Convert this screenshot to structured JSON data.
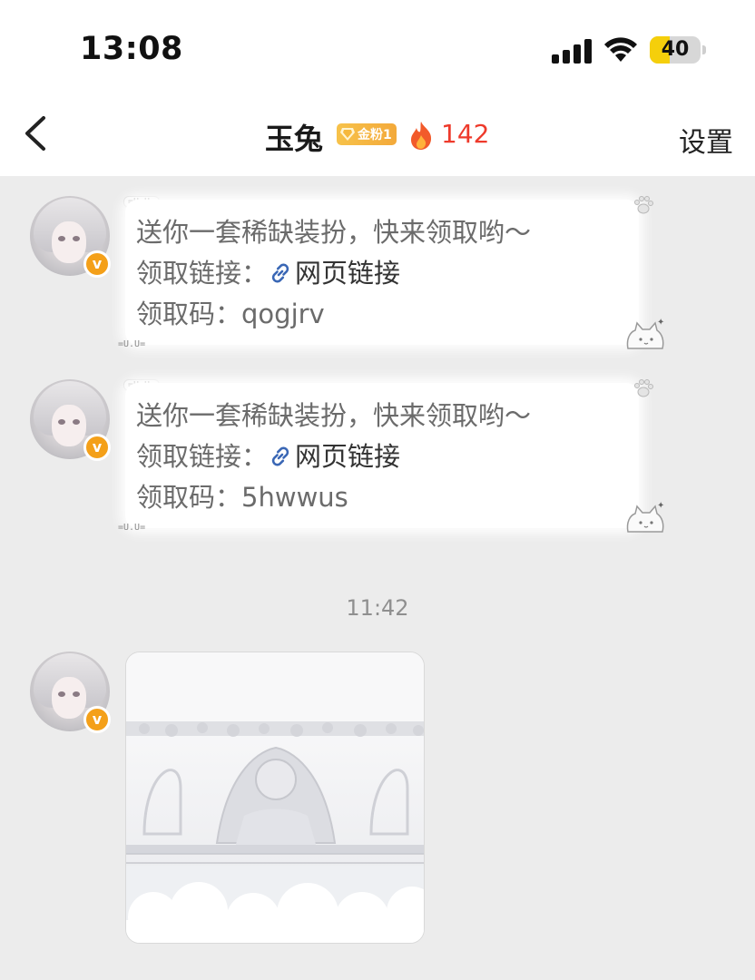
{
  "status_bar": {
    "time": "13:08",
    "battery_level": "40",
    "battery_fraction": 0.4,
    "signal_icon": "signal-bars-icon",
    "wifi_icon": "wifi-icon"
  },
  "nav": {
    "back_icon": "chevron-left-icon",
    "title": "玉兔",
    "fan_badge": "金粉1",
    "heat_icon": "flame-icon",
    "heat_count": "142",
    "settings_label": "设置"
  },
  "messages": [
    {
      "line1": "送你一套稀缺装扮，快来领取哟～",
      "link_label": "领取链接：",
      "link_text": "网页链接",
      "code_label": "领取码：",
      "code_value": "qogjrv"
    },
    {
      "line1": "送你一套稀缺装扮，快来领取哟～",
      "link_label": "领取链接：",
      "link_text": "网页链接",
      "code_label": "领取码：",
      "code_value": "5hwwus"
    }
  ],
  "timestamp": "11:42",
  "bubble_decor": "=U.U=",
  "colors": {
    "accent_heat": "#ee3a2b",
    "badge_gold": "#f4a019",
    "battery_yellow": "#f5cf0b",
    "chat_bg": "#ececec"
  }
}
